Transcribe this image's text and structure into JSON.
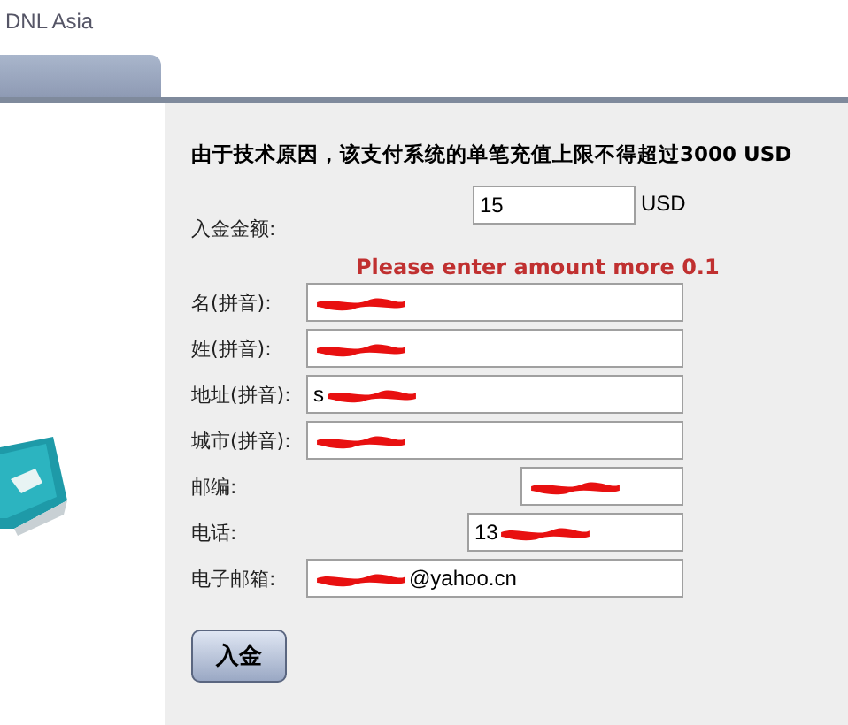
{
  "brand": "DNL Asia",
  "notice": "由于技术原因，该支付系统的单笔充值上限不得超过3000 USD",
  "amount": {
    "label": "入金金额:",
    "value": "15",
    "unit": "USD"
  },
  "error": "Please enter amount more 0.1",
  "fields": [
    {
      "label": "名(拼音):",
      "kind": "wide",
      "redacted": true
    },
    {
      "label": "姓(拼音):",
      "kind": "wide",
      "redacted": true
    },
    {
      "label": "地址(拼音):",
      "prefix": "s",
      "kind": "wide",
      "redacted": true
    },
    {
      "label": "城市(拼音):",
      "kind": "wide",
      "redacted": true
    },
    {
      "label": "邮编:",
      "kind": "narrow",
      "redacted": true
    },
    {
      "label": "电话:",
      "prefix": "13",
      "kind": "medium",
      "redacted": true
    },
    {
      "label": "电子邮箱:",
      "suffix": "@yahoo.cn",
      "kind": "wide",
      "redacted": true
    }
  ],
  "submit": "入金"
}
